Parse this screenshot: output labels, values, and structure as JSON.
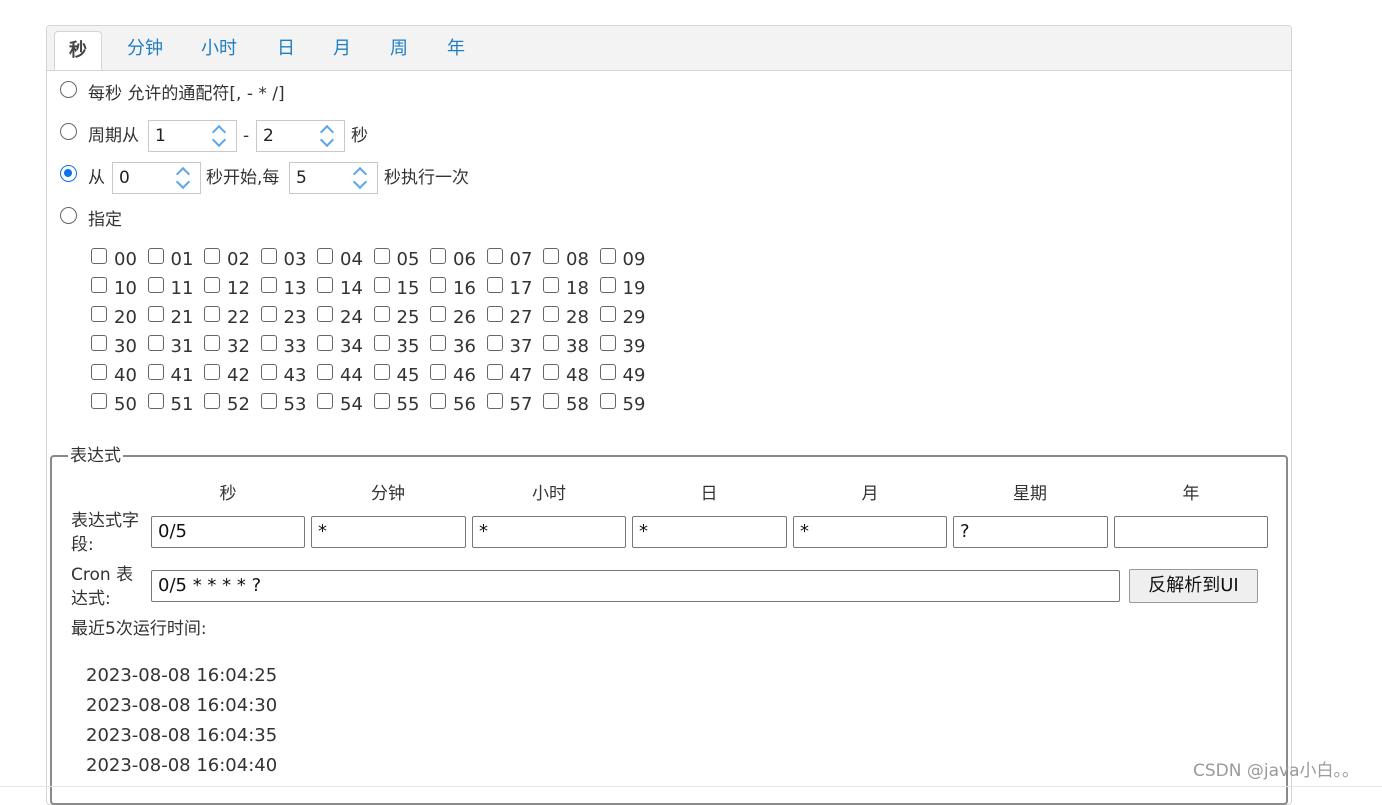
{
  "tabs": [
    "秒",
    "分钟",
    "小时",
    "日",
    "月",
    "周",
    "年"
  ],
  "active_tab": "秒",
  "options": {
    "every": {
      "label": "每秒 允许的通配符[, - * /]"
    },
    "cycle": {
      "prefix": "周期从",
      "from": "1",
      "separator": "-",
      "to": "2",
      "suffix": "秒"
    },
    "loop": {
      "prefix": "从",
      "start": "0",
      "middle": "秒开始,每",
      "step": "5",
      "suffix": "秒执行一次",
      "selected": true
    },
    "specify": {
      "label": "指定"
    }
  },
  "seconds": [
    "00",
    "01",
    "02",
    "03",
    "04",
    "05",
    "06",
    "07",
    "08",
    "09",
    "10",
    "11",
    "12",
    "13",
    "14",
    "15",
    "16",
    "17",
    "18",
    "19",
    "20",
    "21",
    "22",
    "23",
    "24",
    "25",
    "26",
    "27",
    "28",
    "29",
    "30",
    "31",
    "32",
    "33",
    "34",
    "35",
    "36",
    "37",
    "38",
    "39",
    "40",
    "41",
    "42",
    "43",
    "44",
    "45",
    "46",
    "47",
    "48",
    "49",
    "50",
    "51",
    "52",
    "53",
    "54",
    "55",
    "56",
    "57",
    "58",
    "59"
  ],
  "expression": {
    "legend": "表达式",
    "columns": [
      "秒",
      "分钟",
      "小时",
      "日",
      "月",
      "星期",
      "年"
    ],
    "field_label_1": "表达式字",
    "field_label_2": "段:",
    "fields": [
      "0/5",
      "*",
      "*",
      "*",
      "*",
      "?",
      ""
    ],
    "cron_label_1": "Cron 表",
    "cron_label_2": "达式:",
    "cron_value": "0/5 * * * * ?",
    "parse_button": "反解析到UI",
    "recent_label": "最近5次运行时间:",
    "recent_times": [
      "2023-08-08 16:04:25",
      "2023-08-08 16:04:30",
      "2023-08-08 16:04:35",
      "2023-08-08 16:04:40"
    ]
  },
  "watermark": "CSDN @java小白。。"
}
